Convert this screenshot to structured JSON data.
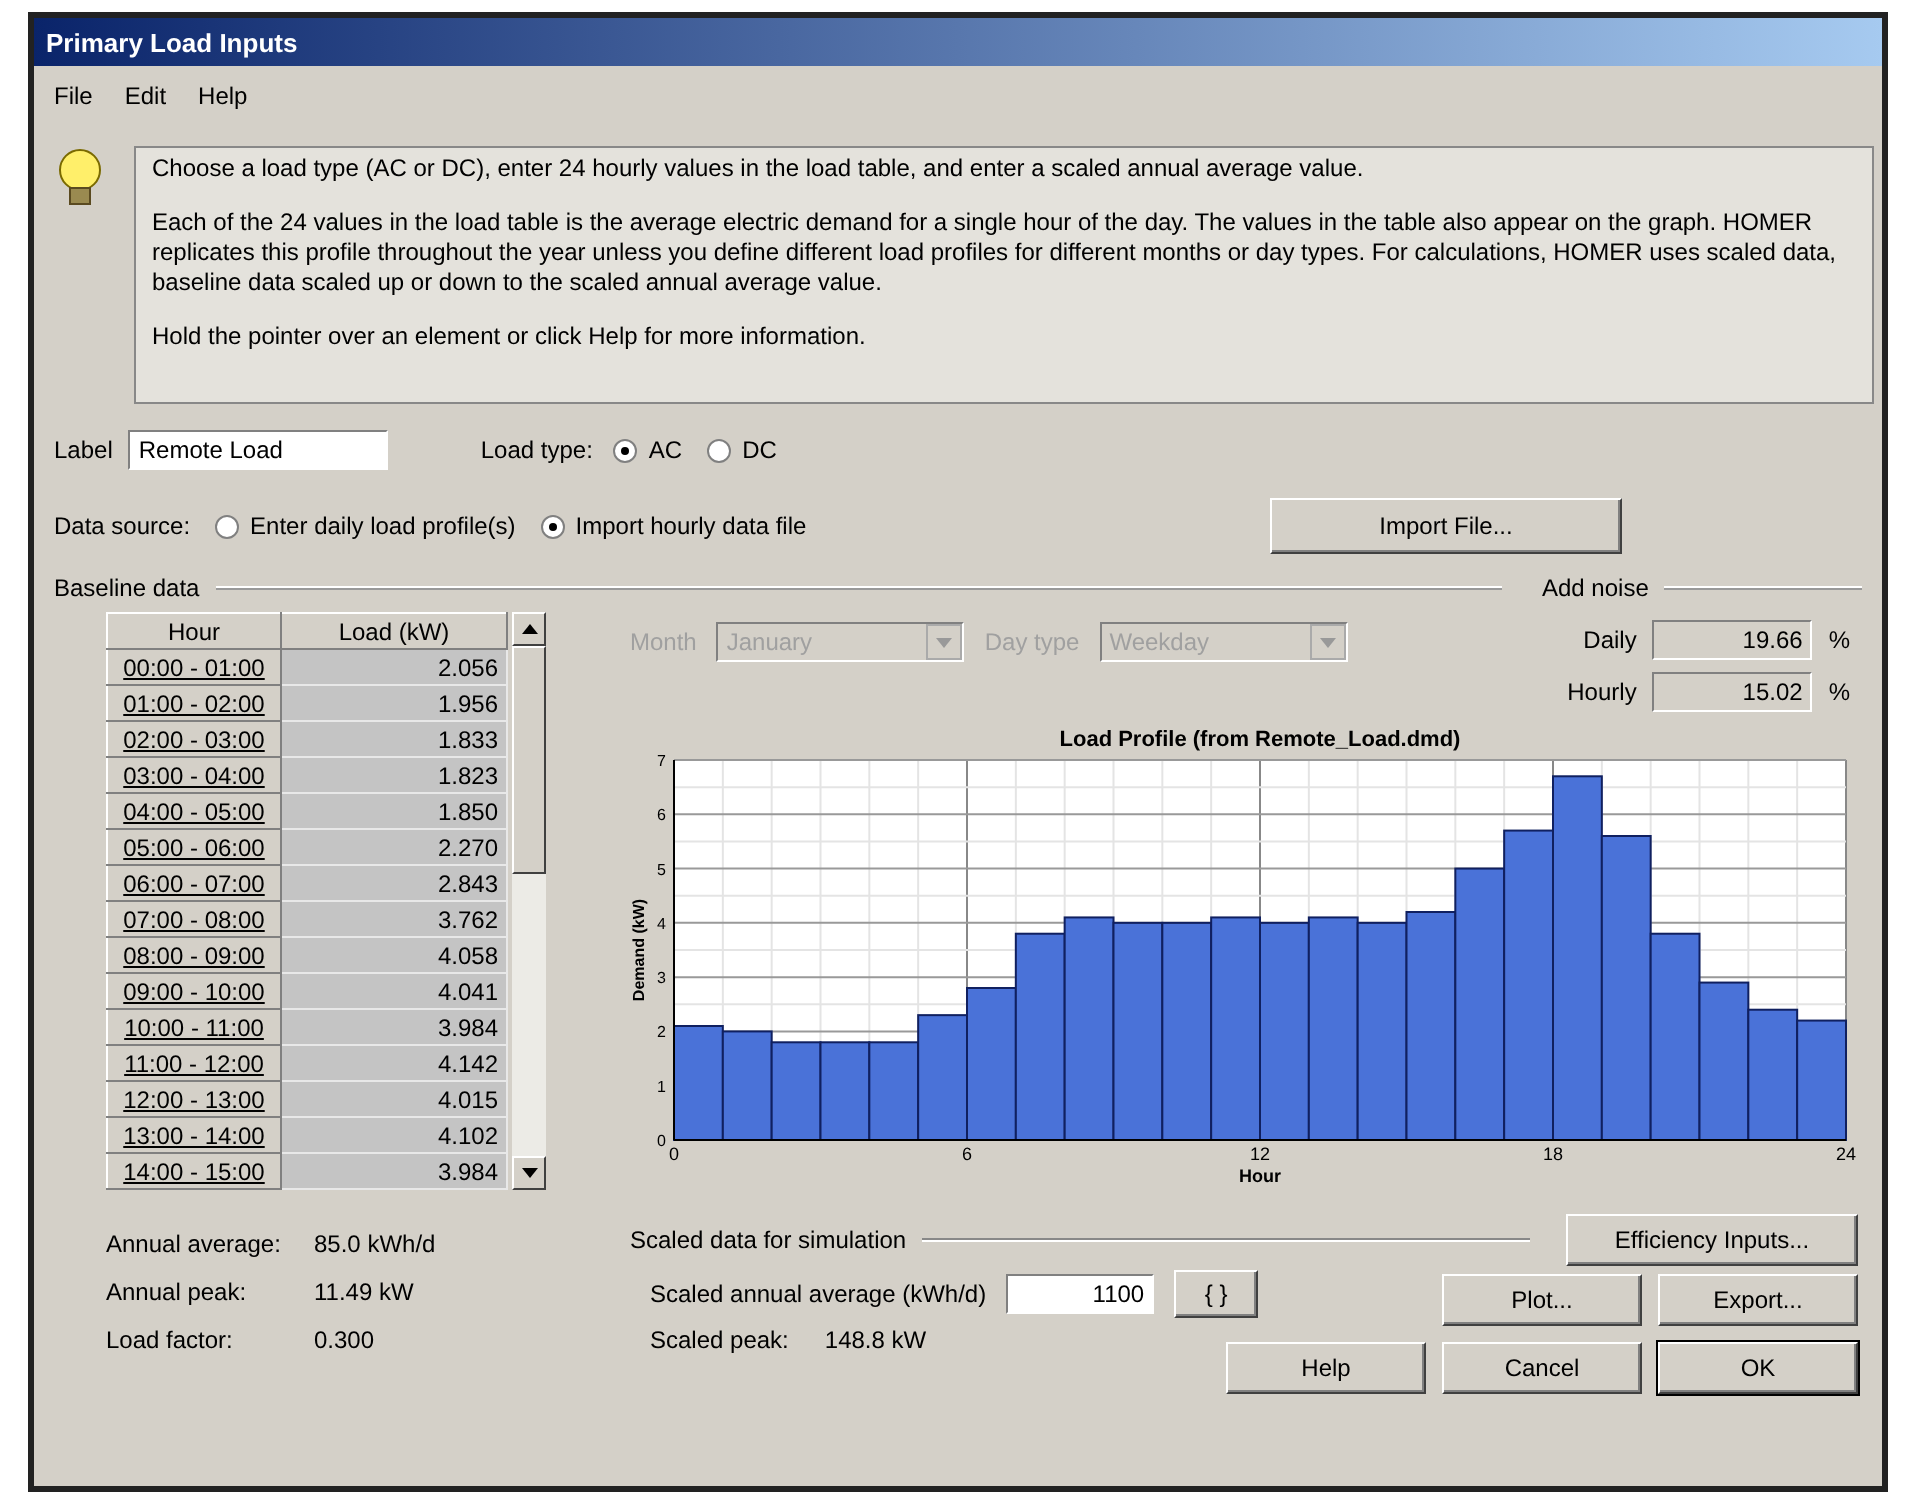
{
  "window": {
    "title": "Primary Load Inputs"
  },
  "menu": [
    "File",
    "Edit",
    "Help"
  ],
  "info": {
    "paragraphs": [
      "Choose a load type (AC or DC), enter 24 hourly values in the load table, and enter a scaled annual average value.",
      "Each of the 24 values in the load table is the average electric demand for a single hour of the day. The values in the table also appear on the graph. HOMER replicates this profile throughout the year unless you define different load profiles for different months or day types. For calculations, HOMER uses scaled data, baseline data scaled up or down to the scaled annual average value.",
      "Hold the pointer over an element or click Help for more information."
    ]
  },
  "label_field": {
    "label": "Label",
    "value": "Remote Load"
  },
  "load_type": {
    "label": "Load type:",
    "options": [
      {
        "label": "AC",
        "selected": true
      },
      {
        "label": "DC",
        "selected": false
      }
    ]
  },
  "data_source": {
    "label": "Data source:",
    "options": [
      {
        "label": "Enter daily load profile(s)",
        "selected": false
      },
      {
        "label": "Import hourly data file",
        "selected": true
      }
    ]
  },
  "import_button": "Import File...",
  "baseline": {
    "title": "Baseline data",
    "columns": [
      "Hour",
      "Load (kW)"
    ],
    "rows": [
      [
        "00:00 - 01:00",
        "2.056"
      ],
      [
        "01:00 - 02:00",
        "1.956"
      ],
      [
        "02:00 - 03:00",
        "1.833"
      ],
      [
        "03:00 - 04:00",
        "1.823"
      ],
      [
        "04:00 - 05:00",
        "1.850"
      ],
      [
        "05:00 - 06:00",
        "2.270"
      ],
      [
        "06:00 - 07:00",
        "2.843"
      ],
      [
        "07:00 - 08:00",
        "3.762"
      ],
      [
        "08:00 - 09:00",
        "4.058"
      ],
      [
        "09:00 - 10:00",
        "4.041"
      ],
      [
        "10:00 - 11:00",
        "3.984"
      ],
      [
        "11:00 - 12:00",
        "4.142"
      ],
      [
        "12:00 - 13:00",
        "4.015"
      ],
      [
        "13:00 - 14:00",
        "4.102"
      ],
      [
        "14:00 - 15:00",
        "3.984"
      ]
    ],
    "stats": [
      {
        "label": "Annual average:",
        "value": "85.0 kWh/d"
      },
      {
        "label": "Annual peak:",
        "value": "11.49 kW"
      },
      {
        "label": "Load factor:",
        "value": "0.300"
      }
    ],
    "selectors": [
      {
        "label": "Month",
        "value": "January",
        "disabled": true
      },
      {
        "label": "Day type",
        "value": "Weekday",
        "disabled": true
      }
    ]
  },
  "noise": {
    "title": "Add noise",
    "fields": [
      {
        "label": "Daily",
        "value": "19.66",
        "unit": "%"
      },
      {
        "label": "Hourly",
        "value": "15.02",
        "unit": "%"
      }
    ]
  },
  "chart": {
    "chart_data": {
      "type": "bar",
      "title": "Load Profile (from Remote_Load.dmd)",
      "xlabel": "Hour",
      "ylabel": "Demand (kW)",
      "x": [
        0.5,
        1.5,
        2.5,
        3.5,
        4.5,
        5.5,
        6.5,
        7.5,
        8.5,
        9.5,
        10.5,
        11.5,
        12.5,
        13.5,
        14.5,
        15.5,
        16.5,
        17.5,
        18.5,
        19.5,
        20.5,
        21.5,
        22.5,
        23.5
      ],
      "series": [
        {
          "color": "#4a72d8",
          "values": [
            2.1,
            2.0,
            1.8,
            1.8,
            1.8,
            2.3,
            2.8,
            3.8,
            4.1,
            4.0,
            4.0,
            4.1,
            4.0,
            4.1,
            4.0,
            4.2,
            5.0,
            5.7,
            6.7,
            5.6,
            3.8,
            2.9,
            2.4,
            2.2
          ]
        }
      ],
      "xlim": [
        0,
        24
      ],
      "ylim": [
        0,
        7
      ],
      "xticks": [
        0,
        6,
        12,
        18,
        24
      ],
      "yticks": [
        0,
        1,
        2,
        3,
        4,
        5,
        6,
        7
      ],
      "grid": true
    }
  },
  "scaled": {
    "title": "Scaled data for simulation",
    "average_label": "Scaled annual average (kWh/d)",
    "average_value": "1100",
    "sensitivity_button": "{ }",
    "peak_label": "Scaled peak:",
    "peak_value": "148.8 kW"
  },
  "buttons": [
    {
      "label": "Efficiency Inputs...",
      "default": false
    },
    {
      "label": "Plot...",
      "default": false
    },
    {
      "label": "Export...",
      "default": false
    },
    {
      "label": "Help",
      "default": false
    },
    {
      "label": "Cancel",
      "default": false
    },
    {
      "label": "OK",
      "default": true
    }
  ]
}
